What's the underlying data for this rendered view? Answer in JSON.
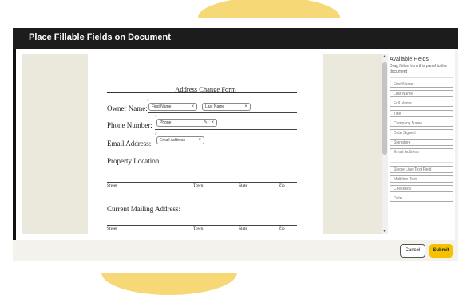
{
  "dialog": {
    "title": "Place Fillable Fields on Document"
  },
  "document": {
    "form_title": "Address Change Form",
    "owner_label": "Owner Name:",
    "phone_label": "Phone Number:",
    "email_label": "Email Address:",
    "property_label": "Property Location:",
    "mailing_label": "Current Mailing Address:",
    "address_columns": [
      "Street",
      "Town",
      "State",
      "Zip"
    ]
  },
  "placed_fields": {
    "first_name": "First Name",
    "last_name": "Last Name",
    "phone": "Phone",
    "email": "Email Address",
    "remove_glyph": "×",
    "edit_glyph": "✎",
    "required_glyph": "*"
  },
  "panel": {
    "title": "Available Fields",
    "description": "Drag fields from this panel to the document",
    "group1": [
      "First Name",
      "Last Name",
      "Full Name",
      "Title",
      "Company Name",
      "Date Signed",
      "Signature",
      "Email Address"
    ],
    "group2": [
      "Single Line Text Field",
      "Multiline Text",
      "Checkbox",
      "Date"
    ]
  },
  "footer": {
    "cancel_label": "Cancel",
    "submit_label": "Submit"
  },
  "colors": {
    "accent": "#f5c100",
    "titlebar": "#1c1c1c",
    "blob": "#f7d877"
  }
}
